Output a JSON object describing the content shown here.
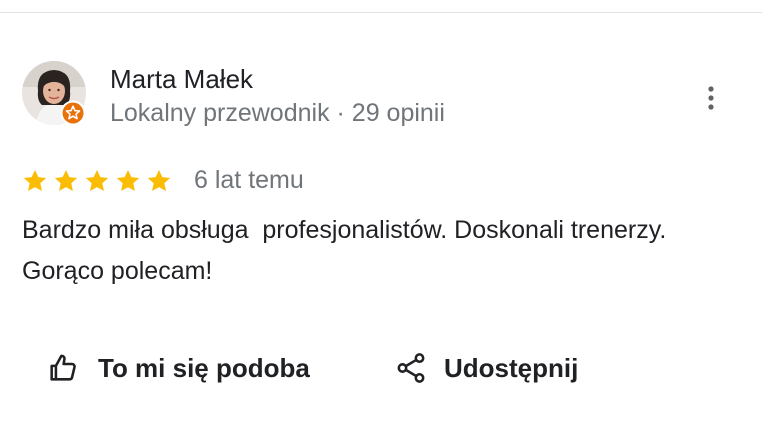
{
  "review": {
    "author_name": "Marta Małek",
    "author_meta": "Lokalny przewodnik · 29 opinii",
    "rating": 5,
    "rating_max": 5,
    "time_ago": "6 lat temu",
    "text": "Bardzo miła obsługa  profesjonalistów. Doskonali trenerzy.  Gorąco polecam!"
  },
  "actions": {
    "like_label": "To mi się podoba",
    "share_label": "Udostępnij"
  },
  "icons": {
    "avatar": "avatar",
    "badge": "local-guide-badge-icon",
    "more": "more-vert-icon",
    "star": "star-icon",
    "like": "thumb-up-icon",
    "share": "share-icon"
  },
  "colors": {
    "star": "#fbbc04",
    "badge": "#e8710a",
    "text_primary": "#202124",
    "text_secondary": "#70757a"
  }
}
